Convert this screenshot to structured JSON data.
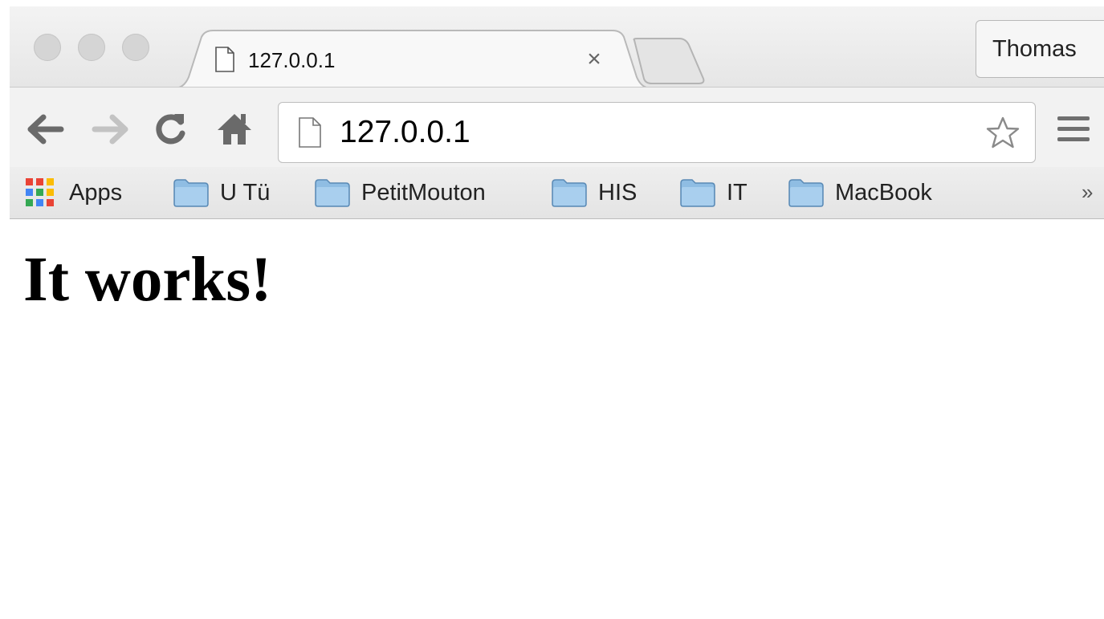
{
  "browser": {
    "tab": {
      "title": "127.0.0.1",
      "close_symbol": "×",
      "icon": "page-icon"
    },
    "profile_button": "Thomas",
    "omnibox": {
      "url": "127.0.0.1",
      "icon": "page-icon",
      "bookmark_icon": "star-icon"
    },
    "nav_icons": [
      "back-arrow-icon",
      "forward-arrow-icon",
      "reload-icon",
      "home-icon",
      "hamburger-menu-icon"
    ]
  },
  "bookmarks": {
    "apps_label": "Apps",
    "items": [
      {
        "label": "U Tü",
        "icon": "folder-icon"
      },
      {
        "label": "PetitMouton",
        "icon": "folder-icon"
      },
      {
        "label": "HIS",
        "icon": "folder-icon"
      },
      {
        "label": "IT",
        "icon": "folder-icon"
      },
      {
        "label": "MacBook",
        "icon": "folder-icon"
      }
    ],
    "overflow_symbol": "»"
  },
  "page": {
    "heading": "It works!"
  },
  "colors": {
    "folder": "#8fbde3",
    "apps_grid": [
      "#e94335",
      "#fbbc05",
      "#34a853",
      "#4285f4"
    ]
  }
}
